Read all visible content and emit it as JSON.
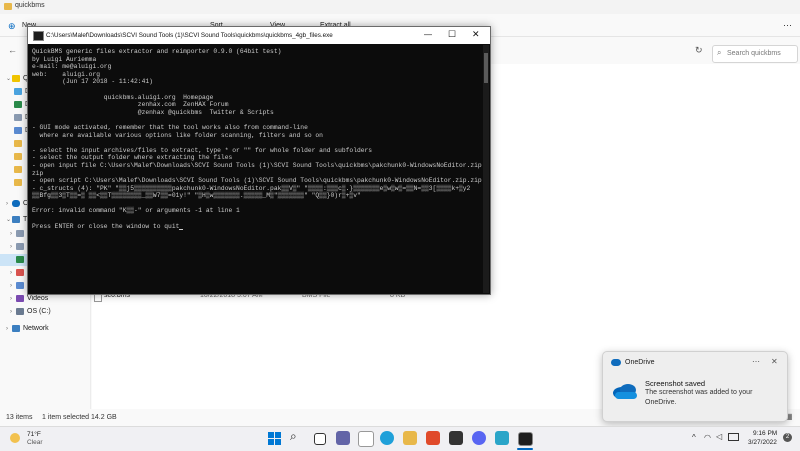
{
  "explorer": {
    "title": "quickbms",
    "toolbar": {
      "new": "New",
      "sort": "Sort",
      "view": "View",
      "extract_all": "Extract all"
    },
    "search_placeholder": "Search quickbms",
    "nav": {
      "quick_access_prefix": "Q",
      "onedrive_prefix": "O",
      "this_pc_prefix": "Th",
      "videos": "Videos",
      "os_drive": "OS (C:)",
      "network": "Network",
      "letters": [
        "D",
        "D",
        "D",
        "D",
        "D",
        "D",
        "D",
        "M",
        "P"
      ]
    },
    "file_row": {
      "name": "sc6.bms",
      "date": "10/22/2018 5:07 AM",
      "type": "BMS File",
      "size": "8 KB"
    },
    "status": {
      "items": "13 items",
      "selected": "1 item selected  14.2 GB"
    }
  },
  "console": {
    "title": "C:\\Users\\Malef\\Downloads\\SCVI Sound Tools (1)\\SCVI Sound Tools\\quickbms\\quickbms_4gb_files.exe",
    "lines": [
      "QuickBMS generic files extractor and reimporter 0.9.0 (64bit test)",
      "by Luigi Auriemma",
      "e-mail: me@aluigi.org",
      "web:    aluigi.org",
      "        (Jun 17 2018 - 11:42:41)",
      "",
      "                   quickbms.aluigi.org  Homepage",
      "                            zenhax.com  ZenHAX Forum",
      "                            @zenhax @quickbms  Twitter & Scripts",
      "",
      "- GUI mode activated, remember that the tool works also from command-line",
      "  where are available various options like folder scanning, filters and so on",
      "",
      "- select the input archives/files to extract, type * or \"\" for whole folder and subfolders",
      "- select the output folder where extracting the files",
      "- open input file C:\\Users\\Malef\\Downloads\\SCVI Sound Tools (1)\\SCVI Sound Tools\\quickbms\\pakchunk0-WindowsNoEditor.zip.",
      "zip",
      "- open script C:\\Users\\Malef\\Downloads\\SCVI Sound Tools (1)\\SCVI Sound Tools\\quickbms\\pakchunk0-WindowsNoEditor.zip.zip",
      "- c_structs (4): \"PK\u0003\u0004\" \"▒▒j5▒▒▒▒▒▒▒▒▒▒pakchunk0-WindowsNoEditor.pak▒▒V▒\" \"▒▒▒▒:▒▒▒c▒.}▒▒▒▒▒▒▒e▒w▒w▒=▒▒N=▒▒3[▒▒▒▒k+▒y2",
      "▒▒Bfg▒▒3▒T▒▒=▒ ▒▒<▒▒T▒▒▒▒▒▒▒▒_▒▒W7▒▒=01y!\" \"▒H▒w▒▒▒▒▒▒▒.▒▒▒▒▒_M▒\"▒▒▒▒▒▒▒\" \"Q▒▒}0)r▒+▒v\"",
      "",
      "Error: invalid command \"K▒▒-\" or arguments -1 at line 1",
      "",
      "Press ENTER or close the window to quit"
    ]
  },
  "notification": {
    "app": "OneDrive",
    "title": "Screenshot saved",
    "body_line1": "The screenshot was added to your",
    "body_line2": "OneDrive."
  },
  "taskbar": {
    "weather_temp": "71°F",
    "weather_desc": "Clear",
    "time": "9:16 PM",
    "date": "3/27/2022",
    "badge": "2"
  },
  "colors": {
    "accent": "#0067c0",
    "console_bg": "#0c0c0c",
    "console_text": "#cccccc",
    "folder": "#e8b84a",
    "onedrive": "#0f6cbd"
  }
}
